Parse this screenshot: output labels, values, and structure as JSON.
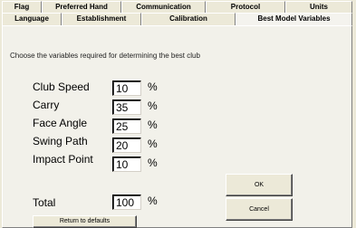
{
  "tabs_back": [
    "Flag",
    "Preferred Hand",
    "Communication",
    "Protocol",
    "Units"
  ],
  "tabs_front": [
    "Language",
    "Establishment",
    "Calibration",
    "Best Model Variables"
  ],
  "instruction": "Choose the variables required for determining the best club",
  "variables": [
    {
      "label": "Club Speed",
      "value": "10"
    },
    {
      "label": "Carry",
      "value": "35"
    },
    {
      "label": "Face Angle",
      "value": "25"
    },
    {
      "label": "Swing Path",
      "value": "20"
    },
    {
      "label": "Impact Point",
      "value": "10"
    }
  ],
  "percent_sign": "%",
  "total": {
    "label": "Total",
    "value": "100"
  },
  "buttons": {
    "ok": "OK",
    "cancel": "Cancel",
    "defaults": "Return to defaults"
  }
}
